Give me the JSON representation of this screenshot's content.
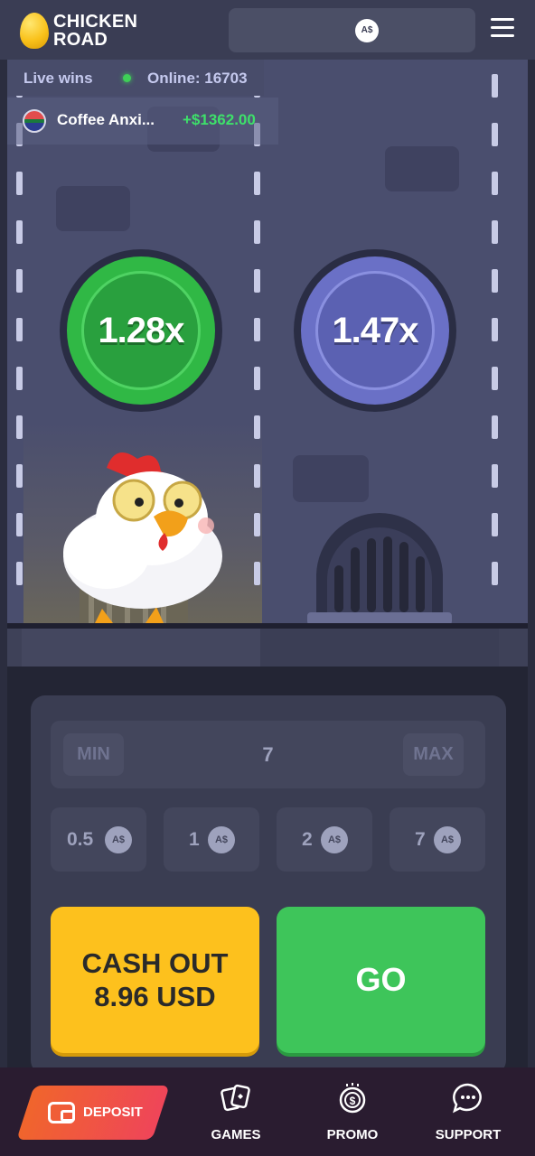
{
  "header": {
    "logo_line1": "CHICKEN",
    "logo_line2": "ROAD",
    "currency_badge": "A$",
    "menu_icon": "hamburger-menu-icon"
  },
  "live": {
    "label": "Live wins",
    "online_text": "Online: 16703",
    "recent_win": {
      "player": "Coffee Anxi...",
      "amount": "+$1362.00",
      "flag_icon": "south-africa-flag-icon"
    }
  },
  "lanes": [
    {
      "multiplier": "1.28x",
      "state": "passed",
      "color": "#30b845"
    },
    {
      "multiplier": "1.47x",
      "state": "next",
      "color": "#6a70c6"
    }
  ],
  "controls": {
    "min_label": "MIN",
    "max_label": "MAX",
    "bet_value": "7",
    "chips": [
      {
        "value": "0.5",
        "currency": "A$"
      },
      {
        "value": "1",
        "currency": "A$"
      },
      {
        "value": "2",
        "currency": "A$"
      },
      {
        "value": "7",
        "currency": "A$"
      }
    ],
    "cashout_line1": "CASH OUT",
    "cashout_line2": "8.96 USD",
    "go_label": "GO"
  },
  "bottom_nav": {
    "deposit_label": "DEPOSIT",
    "items": [
      {
        "label": "GAMES",
        "icon": "cards-icon"
      },
      {
        "label": "PROMO",
        "icon": "dollar-coin-icon"
      },
      {
        "label": "SUPPORT",
        "icon": "chat-bubble-icon"
      }
    ]
  },
  "colors": {
    "accent_green": "#3ec55a",
    "accent_yellow": "#fdc11d",
    "win_green": "#3ee06a",
    "deposit_gradient_start": "#f0652c",
    "deposit_gradient_end": "#ef4559"
  }
}
